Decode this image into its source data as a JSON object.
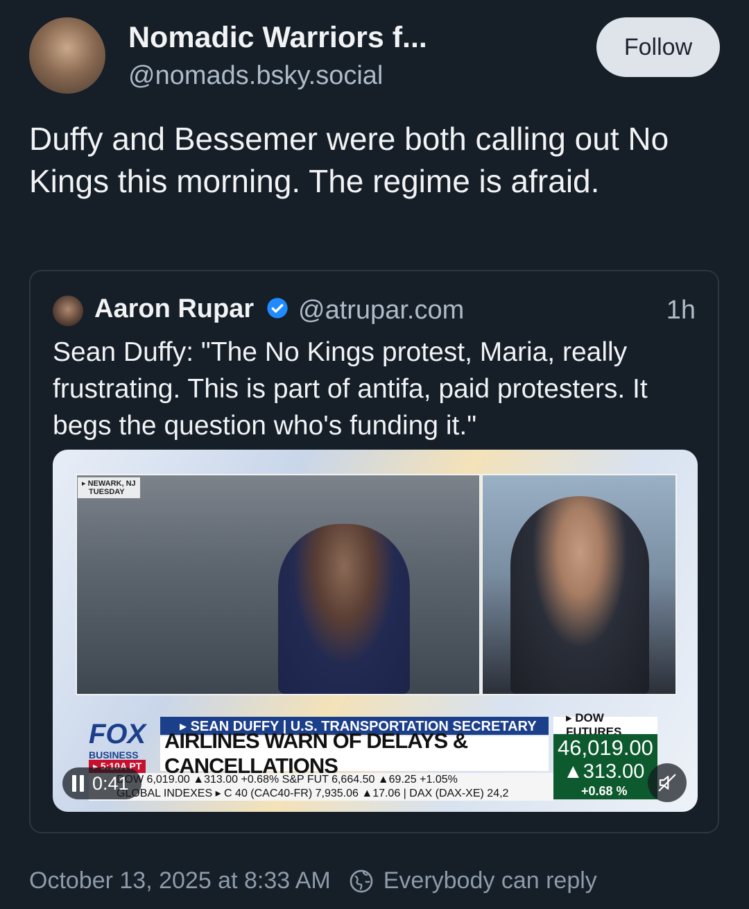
{
  "author": {
    "name": "Nomadic Warriors f...",
    "handle": "@nomads.bsky.social",
    "follow_label": "Follow"
  },
  "post": {
    "text": "Duffy and Bessemer were both calling out No Kings this morning. The regime is afraid.",
    "timestamp": "October 13, 2025 at 8:33 AM",
    "reply_setting": "Everybody can reply"
  },
  "quote": {
    "name": "Aaron Rupar",
    "handle": "@atrupar.com",
    "time": "1h",
    "verified": true,
    "text": "Sean Duffy: \"The No Kings protest, Maria, really frustrating. This is part of antifa, paid protesters. It begs the question who's funding it.\""
  },
  "video": {
    "duration": "0:41",
    "location_tag_line1": "▸ NEWARK, NJ",
    "location_tag_line2": "TUESDAY",
    "network_logo": "FOX",
    "network_sub": "BUSINESS",
    "local_time": "▸ 5:10A PT",
    "chyron_top": "▸ SEAN DUFFY | U.S. TRANSPORTATION SECRETARY",
    "chyron_main": "AIRLINES WARN OF DELAYS & CANCELLATIONS",
    "dow_label": "▸ DOW FUTURES",
    "dow_value": "46,019.00",
    "dow_change": "▲313.00",
    "dow_pct": "+0.68 %",
    "ticker_line1": "DOW   6,019.00 ▲313.00 +0.68%  S&P FUT   6,664.50 ▲69.25 +1.05%",
    "ticker_line2": "GLOBAL INDEXES ▸ C 40 (CAC40-FR) 7,935.06 ▲17.06 | DAX (DAX-XE) 24,2"
  },
  "colors": {
    "background": "#161e27",
    "text_primary": "#f1f3f5",
    "text_secondary": "#aebbc9",
    "verified_blue": "#208bfe",
    "follow_bg": "#dfe4ea"
  },
  "icons": [
    "verified-badge-icon",
    "pause-icon",
    "mute-icon",
    "globe-icon"
  ]
}
